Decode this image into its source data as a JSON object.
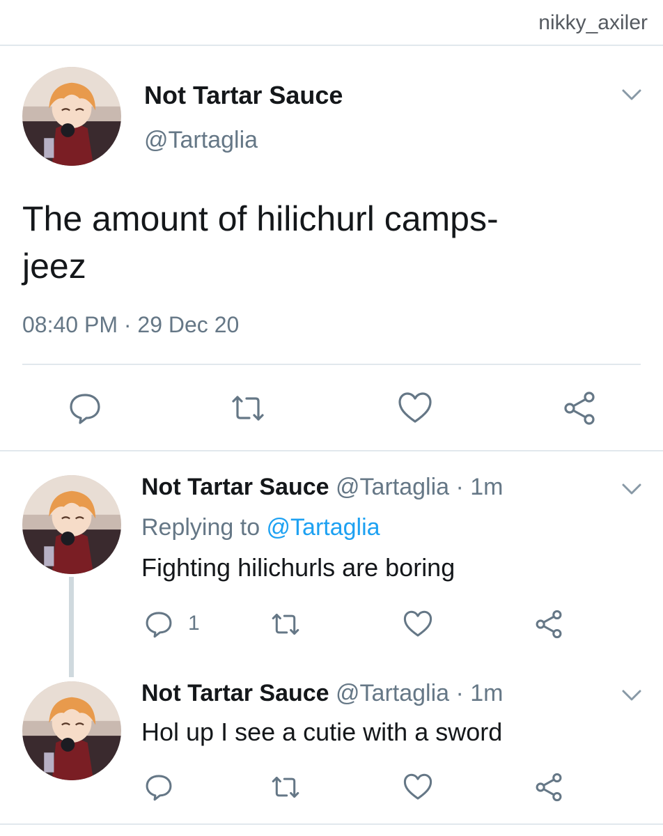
{
  "watermark": "nikky_axiler",
  "main_tweet": {
    "name": "Not Tartar Sauce",
    "handle": "@Tartaglia",
    "text_line1": "The amount of hilichurl camps-",
    "text_line2": "jeez",
    "timestamp": "08:40 PM · 29 Dec 20",
    "actions": [
      "reply-icon",
      "retweet-icon",
      "like-icon",
      "share-icon"
    ]
  },
  "replies": [
    {
      "name": "Not Tartar Sauce",
      "handle": "@Tartaglia",
      "sep": " · ",
      "time": "1m",
      "replying_prefix": "Replying to ",
      "replying_handle": "@Tartaglia",
      "text": "Fighting hilichurls are boring",
      "reply_count": "1"
    },
    {
      "name": "Not Tartar Sauce",
      "handle": "@Tartaglia",
      "sep": " · ",
      "time": "1m",
      "text": "Hol up I see a cutie with a sword"
    }
  ],
  "colors": {
    "primary_text": "#14171a",
    "secondary_text": "#657786",
    "link": "#1da1f2",
    "divider": "#e1e8ed"
  }
}
